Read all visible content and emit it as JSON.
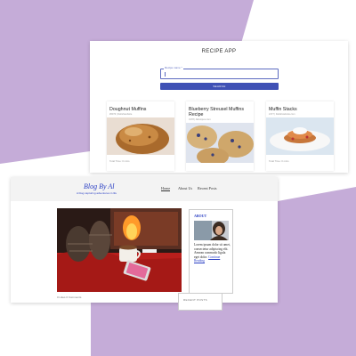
{
  "colors": {
    "background_lavender": "#c5acd8",
    "primary_indigo": "#3f51b5",
    "blog_blue": "#2a3fc4"
  },
  "recipe_app": {
    "title": "RECIPE APP",
    "search": {
      "label": "Recipe name *",
      "value": ""
    },
    "search_button_label": "SEARCH",
    "cards": [
      {
        "title": "Doughnut Muffins",
        "subtitle": "#6073 | Delishwebsite",
        "footer": "Total Time: 0 mins",
        "image": "muffin-photo"
      },
      {
        "title": "Blueberry Streusel Muffins Recipe",
        "subtitle": "3178 | Allrecipes.com",
        "footer": "",
        "image": "blueberry-muffin-photo"
      },
      {
        "title": "Muffin Stacks",
        "subtitle": "2177 | Delishwebsite.com",
        "footer": "Total Time: 0 mins",
        "image": "muffin-stack-photo"
      }
    ]
  },
  "blog": {
    "title": "Blog By Al",
    "tagline": "A blog capturing adventures in life",
    "nav": [
      {
        "label": "Home",
        "active": true
      },
      {
        "label": "About Us",
        "active": false
      },
      {
        "label": "Recent Posts",
        "active": false
      }
    ],
    "hero_caption": "0 Likes 0 Comments",
    "about": {
      "title": "ABOUT",
      "text": "Lorem ipsum dolor sit amet, consectetur adipiscing elit. Aenean commodo ligula eget dolor.",
      "link": "Continue Reading"
    },
    "second_widget_title": "RECENT POSTS"
  }
}
